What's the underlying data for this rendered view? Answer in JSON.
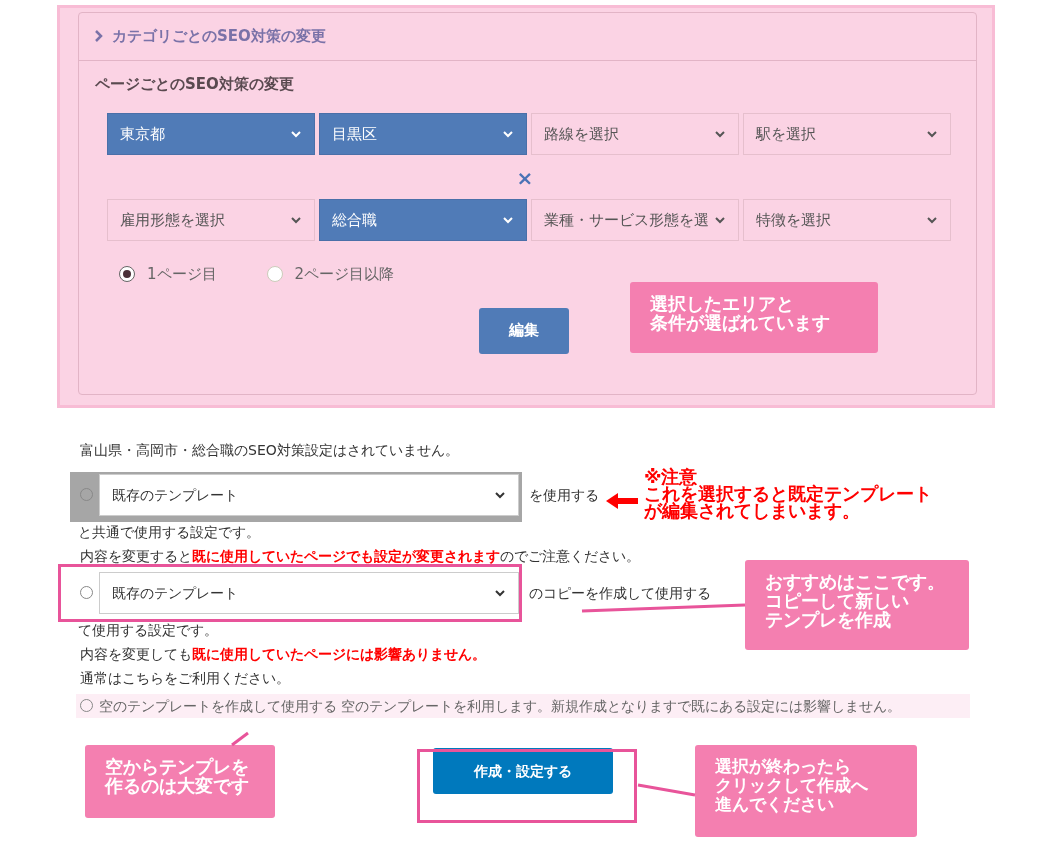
{
  "seo_panel": {
    "category_header": {
      "label": "カテゴリごとのSEO対策の変更",
      "expanded": false
    },
    "page_section": {
      "title": "ページごとのSEO対策の変更",
      "area_selects": [
        {
          "value": "東京都",
          "selected": true
        },
        {
          "value": "目黒区",
          "selected": true
        },
        {
          "value": "路線を選択",
          "selected": false
        },
        {
          "value": "駅を選択",
          "selected": false
        }
      ],
      "separator": "×",
      "condition_selects": [
        {
          "value": "雇用形態を選択",
          "selected": false
        },
        {
          "value": "総合職",
          "selected": true
        },
        {
          "value": "業種・サービス形態を選",
          "selected": false
        },
        {
          "value": "特徴を選択",
          "selected": false
        }
      ],
      "page_radios": [
        {
          "label": "1ページ目",
          "selected": true
        },
        {
          "label": "2ページ目以降",
          "selected": false
        }
      ],
      "edit_button": "編集"
    }
  },
  "notice": "富山県・高岡市・総合職のSEO対策設定はされていません。",
  "template_options": [
    {
      "kind": "select",
      "selected": false,
      "select_value": "既存のテンプレート",
      "after": "を使用する",
      "lines": [
        "と共通で使用する設定です。",
        "内容を変更すると**既に使用していたページでも設定が変更されます**のでご注意ください。"
      ],
      "shaded": true
    },
    {
      "kind": "select",
      "selected": false,
      "select_value": "既存のテンプレート",
      "after": "のコピーを作成して使用する",
      "lines": [
        "て使用する設定です。",
        "内容を変更しても**既に使用していたページには影響ありません。**",
        "通常はこちらをご利用ください。"
      ],
      "outlined": true
    },
    {
      "kind": "plain",
      "selected": false,
      "label": "空のテンプレートを作成して使用する 空のテンプレートを利用します。新規作成となりますで既にある設定には影響しません。",
      "highlighted": true
    }
  ],
  "submit_button": "作成・設定する",
  "annotations": [
    {
      "kind": "callout",
      "lines": [
        "選択したエリアと",
        "条件が選ばれています"
      ]
    },
    {
      "kind": "warning",
      "lines": [
        "※注意",
        "これを選択すると既定テンプレート",
        "が編集されてしまいます。"
      ]
    },
    {
      "kind": "callout",
      "lines": [
        "おすすめはここです。",
        "コピーして新しい",
        "テンプレを作成"
      ]
    },
    {
      "kind": "callout",
      "lines": [
        "空からテンプレを",
        "作るのは大変です"
      ]
    },
    {
      "kind": "callout",
      "lines": [
        "選択が終わったら",
        "クリックして作成へ",
        "進んでください"
      ]
    }
  ]
}
